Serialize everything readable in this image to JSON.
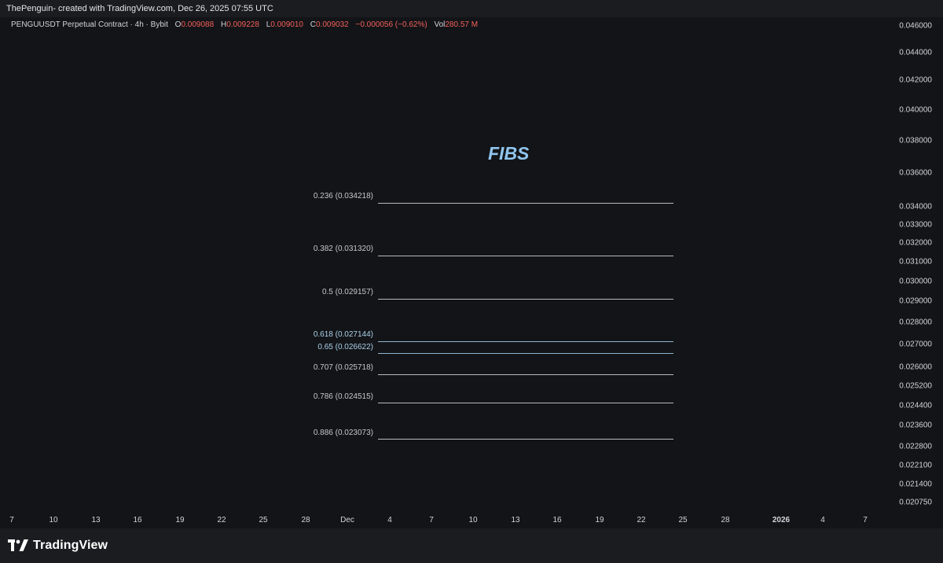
{
  "header": {
    "caption": "ThePenguin- created with TradingView.com, Dec 26, 2025 07:55 UTC"
  },
  "legend": {
    "symbol": "PENGUUSDT Perpetual Contract · 4h · Bybit",
    "open_label": "O",
    "open": "0.009088",
    "high_label": "H",
    "high": "0.009228",
    "low_label": "L",
    "low": "0.009010",
    "close_label": "C",
    "close": "0.009032",
    "change": "−0.000056 (−0.62%)",
    "vol_label": "Vol",
    "vol": "280.57 M"
  },
  "annotation": {
    "title": "FIBS"
  },
  "fib_levels": [
    {
      "label": "0.236 (0.034218)",
      "blue": false
    },
    {
      "label": "0.382 (0.031320)",
      "blue": false
    },
    {
      "label": "0.5 (0.029157)",
      "blue": false
    },
    {
      "label": "0.618 (0.027144)",
      "blue": true
    },
    {
      "label": "0.65 (0.026622)",
      "blue": true
    },
    {
      "label": "0.707 (0.025718)",
      "blue": false
    },
    {
      "label": "0.786 (0.024515)",
      "blue": false
    },
    {
      "label": "0.886 (0.023073)",
      "blue": false
    }
  ],
  "price_axis": {
    "ticks": [
      "0.046000",
      "0.044000",
      "0.042000",
      "0.040000",
      "0.038000",
      "0.036000",
      "0.034000",
      "0.033000",
      "0.032000",
      "0.031000",
      "0.030000",
      "0.029000",
      "0.028000",
      "0.027000",
      "0.026000",
      "0.025200",
      "0.024400",
      "0.023600",
      "0.022800",
      "0.022100",
      "0.021400",
      "0.020750"
    ]
  },
  "time_axis": {
    "ticks": [
      "7",
      "10",
      "13",
      "16",
      "19",
      "22",
      "25",
      "28",
      "Dec",
      "4",
      "7",
      "10",
      "13",
      "16",
      "19",
      "22",
      "25",
      "28",
      "2026",
      "4",
      "7"
    ],
    "year_label": "2026"
  },
  "footer": {
    "brand": "TradingView"
  },
  "colors": {
    "background": "#131417",
    "change_red": "#f2605c",
    "fib_title": "#90c5ee",
    "fib_line": "#b6bac2",
    "fib_line_blue": "#8fb6d0"
  }
}
